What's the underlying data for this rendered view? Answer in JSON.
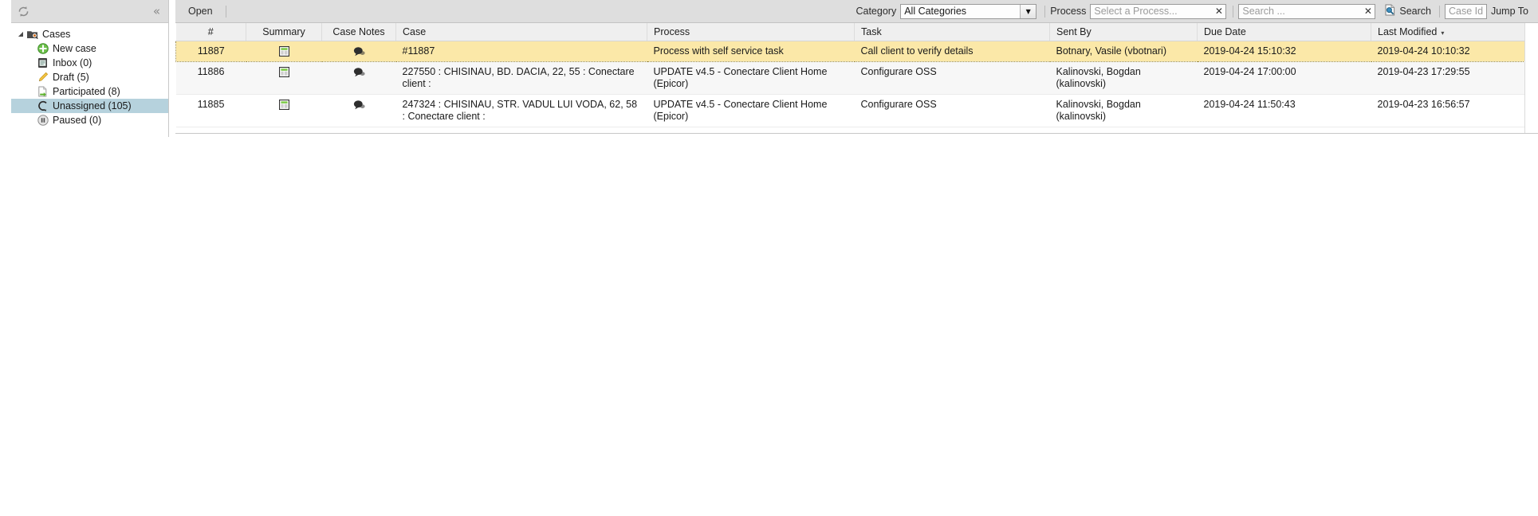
{
  "sidebar": {
    "header": {
      "refresh_icon": "refresh-icon",
      "collapse_icon": "collapse-left-icon",
      "collapse_label": "«"
    },
    "root": {
      "label": "Cases",
      "icon": "cases-folder-icon",
      "expander": "◢"
    },
    "items": [
      {
        "label": "New case",
        "icon": "plus-circle-green-icon",
        "selected": false
      },
      {
        "label": "Inbox (0)",
        "icon": "inbox-icon",
        "selected": false
      },
      {
        "label": "Draft (5)",
        "icon": "pencil-icon",
        "selected": false
      },
      {
        "label": "Participated (8)",
        "icon": "page-arrow-icon",
        "selected": false
      },
      {
        "label": "Unassigned (105)",
        "icon": "unassigned-icon",
        "selected": true
      },
      {
        "label": "Paused (0)",
        "icon": "pause-circle-icon",
        "selected": false
      }
    ]
  },
  "toolbar": {
    "open_label": "Open",
    "category_label": "Category",
    "category_value": "All Categories",
    "category_options": [
      "All Categories"
    ],
    "process_label": "Process",
    "process_placeholder": "Select a Process...",
    "process_value": "",
    "process_clear": "✕",
    "search_placeholder": "Search ...",
    "search_value": "",
    "search_clear": "✕",
    "search_button_label": "Search",
    "search_button_icon": "search-page-icon",
    "caseid_placeholder": "Case Id",
    "caseid_value": "",
    "jumpto_label": "Jump To"
  },
  "grid": {
    "columns": [
      {
        "key": "num",
        "label": "#",
        "align": "center"
      },
      {
        "key": "summary",
        "label": "Summary",
        "align": "center"
      },
      {
        "key": "notes",
        "label": "Case Notes",
        "align": "center"
      },
      {
        "key": "case",
        "label": "Case",
        "align": "left"
      },
      {
        "key": "process",
        "label": "Process",
        "align": "left"
      },
      {
        "key": "task",
        "label": "Task",
        "align": "left"
      },
      {
        "key": "sent_by",
        "label": "Sent By",
        "align": "left"
      },
      {
        "key": "due_date",
        "label": "Due Date",
        "align": "left"
      },
      {
        "key": "last_modified",
        "label": "Last Modified",
        "align": "left",
        "sort": "desc",
        "sort_caret": "▾"
      }
    ],
    "summary_icon": "summary-form-icon",
    "notes_icon": "speech-bubble-icon",
    "rows": [
      {
        "num": "11887",
        "case": "#11887",
        "process": "Process with self service task",
        "task": "Call client to verify details",
        "sent_by": "Botnary, Vasile (vbotnari)",
        "due_date": "2019-04-24 15:10:32",
        "last_modified": "2019-04-24 10:10:32",
        "selected": true
      },
      {
        "num": "11886",
        "case": "227550 : CHISINAU, BD. DACIA, 22, 55 : Conectare client :",
        "process": "UPDATE v4.5 - Conectare Client Home (Epicor)",
        "task": "Configurare OSS",
        "sent_by": "Kalinovski, Bogdan (kalinovski)",
        "due_date": "2019-04-24 17:00:00",
        "last_modified": "2019-04-23 17:29:55",
        "selected": false
      },
      {
        "num": "11885",
        "case": "247324 : CHISINAU, STR. VADUL LUI VODA, 62, 58 : Conectare client :",
        "process": "UPDATE v4.5 - Conectare Client Home (Epicor)",
        "task": "Configurare OSS",
        "sent_by": "Kalinovski, Bogdan (kalinovski)",
        "due_date": "2019-04-24 11:50:43",
        "last_modified": "2019-04-23 16:56:57",
        "selected": false
      }
    ]
  },
  "colors": {
    "selected_row": "#fbe8a8",
    "due_date_text": "#1e7b2e",
    "sidebar_selection": "#b6d2dd",
    "toolbar_bg": "#dedede",
    "header_bg": "#efefef"
  }
}
